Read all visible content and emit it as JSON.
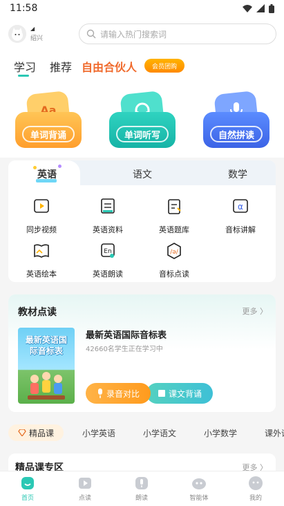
{
  "status_bar": {
    "time": "11:58"
  },
  "header": {
    "city_dot": "◢",
    "city_name": "绍兴",
    "search_placeholder": "请输入热门搜索词"
  },
  "top_tabs": {
    "study": "学习",
    "recommend": "推荐",
    "partner": "自由合伙人",
    "vip_badge": "会员团购"
  },
  "hero": [
    {
      "label": "单词背诵",
      "glyph": "Aa",
      "color": "#ffb84a"
    },
    {
      "label": "单词听写",
      "glyph": "",
      "color": "#2cc9b8"
    },
    {
      "label": "自然拼读",
      "glyph": "",
      "color": "#4b7bf0"
    }
  ],
  "subjects": {
    "tabs": [
      "英语",
      "语文",
      "数学"
    ],
    "active": "英语",
    "tools": [
      {
        "label": "同步视频",
        "icon": "play-video-icon"
      },
      {
        "label": "英语资料",
        "icon": "document-icon"
      },
      {
        "label": "英语题库",
        "icon": "question-bank-icon"
      },
      {
        "label": "音标讲解",
        "icon": "phonetic-icon"
      },
      {
        "label": "英语绘本",
        "icon": "picture-book-icon"
      },
      {
        "label": "英语朗读",
        "icon": "read-aloud-icon"
      },
      {
        "label": "音标点读",
        "icon": "phonetic-point-read-icon"
      }
    ]
  },
  "textbook": {
    "title": "教材点读",
    "more": "更多 〉",
    "cover_title": "最新英语国际音标表",
    "book_name": "最新英语国际音标表",
    "learners": "42660名学生正在学习中",
    "btn_record": "录音对比",
    "btn_recite": "课文背诵"
  },
  "categories": {
    "active": "精品课",
    "items": [
      "小学英语",
      "小学语文",
      "小学数学",
      "课外读"
    ]
  },
  "premium": {
    "title": "精品课专区",
    "more": "更多 〉"
  },
  "bottom_nav": [
    {
      "label": "首页",
      "active": true
    },
    {
      "label": "点读",
      "active": false
    },
    {
      "label": "朗读",
      "active": false
    },
    {
      "label": "智能体",
      "active": false
    },
    {
      "label": "我的",
      "active": false
    }
  ],
  "colors": {
    "accent": "#2bc8b4",
    "orange": "#f06a2c"
  }
}
